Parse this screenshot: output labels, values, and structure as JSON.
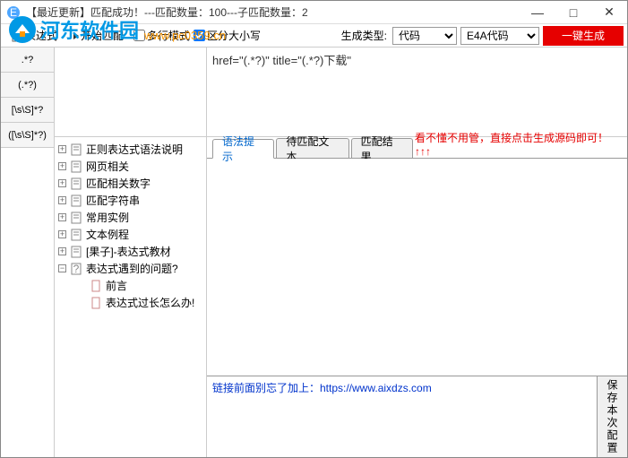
{
  "window": {
    "title": "【最近更新】匹配成功！---匹配数量：100---子匹配数量：2",
    "min": "—",
    "max": "□",
    "close": "✕"
  },
  "toolbar": {
    "expr_btn": "表达式",
    "start_match": "开始匹配",
    "multiline": "多行模式",
    "case_sensitive": "区分大小写",
    "gen_type_label": "生成类型:",
    "gen_type_value": "代码",
    "gen_format_value": "E4A代码",
    "generate": "一键生成"
  },
  "left_tools": {
    "t1": ".*?",
    "t2": "(.*?)",
    "t3": "[\\s\\S]*?",
    "t4": "([\\s\\S]*?)"
  },
  "regex": "href=\"(.*?)\" title=\"(.*?)下载\"",
  "tree": {
    "n1": "正则表达式语法说明",
    "n2": "网页相关",
    "n3": "匹配相关数字",
    "n4": "匹配字符串",
    "n5": "常用实例",
    "n6": "文本例程",
    "n7": "[果子]-表达式教材",
    "n8": "表达式遇到的问题?",
    "n8a": "前言",
    "n8b": "表达式过长怎么办!"
  },
  "tabs": {
    "t1": "语法提示",
    "t2": "待匹配文本",
    "t3": "匹配结果",
    "hint": "看不懂不用管，直接点击生成源码即可！↑↑↑"
  },
  "note": "链接前面别忘了加上：https://www.aixdzs.com",
  "save": "保存本次配置",
  "watermark": {
    "site": "河东软件园",
    "url": "www.pc0359.cn"
  }
}
